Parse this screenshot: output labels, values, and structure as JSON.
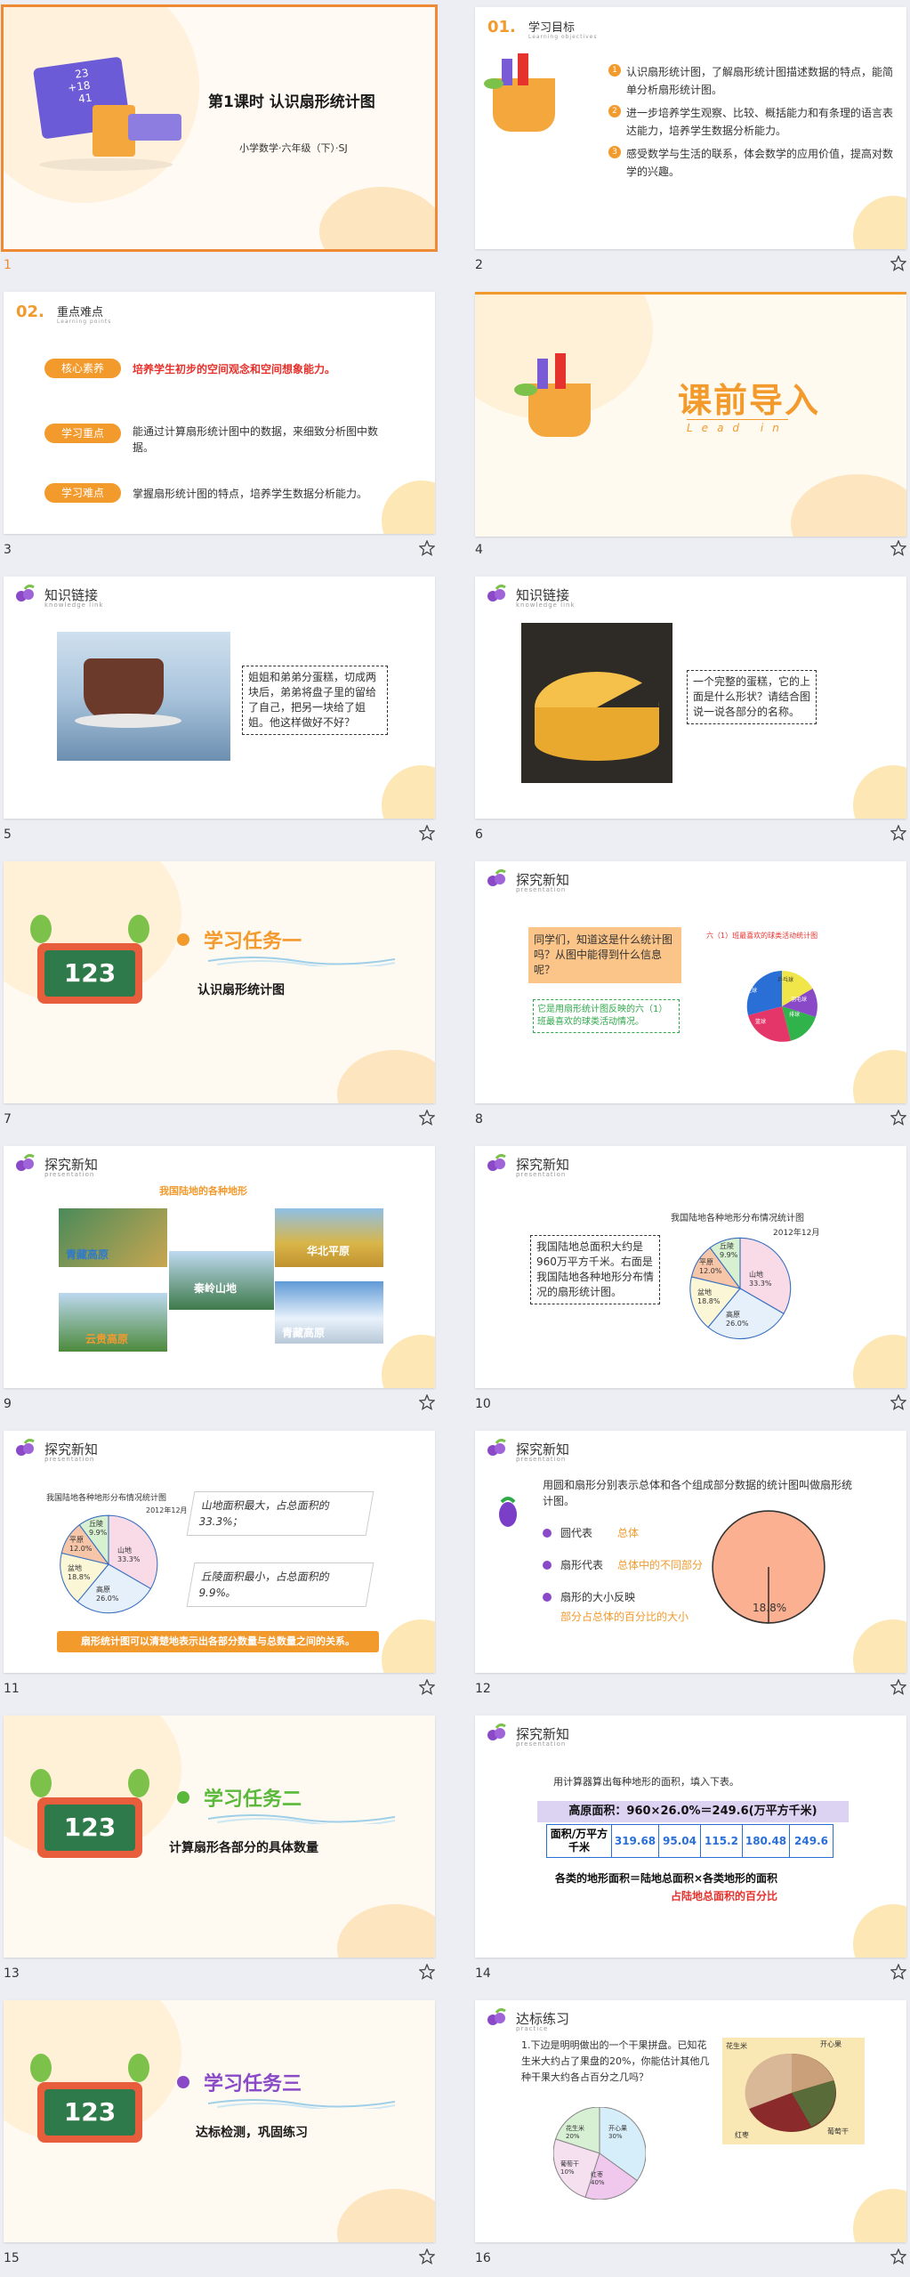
{
  "slides": [
    {
      "num": "1",
      "title": "第1课时 认识扇形统计图",
      "subtitle": "小学数学·六年级（下）·SJ",
      "board": [
        "23",
        "+18",
        "41"
      ]
    },
    {
      "num": "2",
      "section_no": "01.",
      "heading": "学习目标",
      "heading_en": "Learning objectives",
      "goals": [
        "认识扇形统计图，了解扇形统计图描述数据的特点，能简单分析扇形统计图。",
        "进一步培养学生观察、比较、概括能力和有条理的语言表达能力，培养学生数据分析能力。",
        "感受数学与生活的联系，体会数学的应用价值，提高对数学的兴趣。"
      ]
    },
    {
      "num": "3",
      "section_no": "02.",
      "heading": "重点难点",
      "heading_en": "Learning points",
      "rows": [
        {
          "tag": "核心素养",
          "text": "培养学生初步的空间观念和空间想象能力。"
        },
        {
          "tag": "学习重点",
          "text": "能通过计算扇形统计图中的数据，来细致分析图中数据。"
        },
        {
          "tag": "学习难点",
          "text": "掌握扇形统计图的特点，培养学生数据分析能力。"
        }
      ]
    },
    {
      "num": "4",
      "title": "课前导入",
      "title_en": "Lead  in"
    },
    {
      "num": "5",
      "heading": "知识链接",
      "heading_en": "knowledge link",
      "bubble": "姐姐和弟弟分蛋糕，切成两块后，弟弟将盘子里的留给了自己，把另一块给了姐姐。他这样做好不好？"
    },
    {
      "num": "6",
      "heading": "知识链接",
      "heading_en": "knowledge link",
      "bubble": "一个完整的蛋糕，它的上面是什么形状？请结合图说一说各部分的名称。"
    },
    {
      "num": "7",
      "task": "学习任务一",
      "task_sub": "认识扇形统计图"
    },
    {
      "num": "8",
      "heading": "探究新知",
      "heading_en": "presentation",
      "q": "同学们，知道这是什么统计图吗？从图中能得到什么信息呢？",
      "ans": "它是用扇形统计图反映的六（1）班最喜欢的球类活动情况。",
      "chart_title": "六（1）班最喜欢的球类活动统计图",
      "pie_labels": [
        "乒乓球",
        "羽毛球",
        "排球",
        "篮球",
        "足球"
      ]
    },
    {
      "num": "9",
      "heading": "探究新知",
      "heading_en": "presentation",
      "title": "我国陆地的各种地形",
      "places": [
        "青藏高原",
        "华北平原",
        "秦岭山地",
        "云贵高原",
        "青藏高原"
      ]
    },
    {
      "num": "10",
      "heading": "探究新知",
      "heading_en": "presentation",
      "text": "我国陆地总面积大约是960万平方千米。右面是我国陆地各种地形分布情况的扇形统计图。",
      "chart_title": "我国陆地各种地形分布情况统计图",
      "chart_date": "2012年12月",
      "pie": [
        "丘陵 9.9%",
        "平原 12.0%",
        "山地 33.3%",
        "盆地 18.8%",
        "高原 26.0%"
      ]
    },
    {
      "num": "11",
      "heading": "探究新知",
      "heading_en": "presentation",
      "chart_title": "我国陆地各种地形分布情况统计图",
      "chart_date": "2012年12月",
      "pie": [
        "丘陵 9.9%",
        "平原 12.0%",
        "山地 33.3%",
        "盆地 18.8%",
        "高原 26.0%"
      ],
      "note1": "山地面积最大，占总面积的33.3%；",
      "note2": "丘陵面积最小，占总面积的9.9%。",
      "banner": "扇形统计图可以清楚地表示出各部分数量与总数量之间的关系。"
    },
    {
      "num": "12",
      "heading": "探究新知",
      "heading_en": "presentation",
      "intro": "用圆和扇形分别表示总体和各个组成部分数据的统计图叫做扇形统计图。",
      "items": [
        {
          "k": "圆代表",
          "v": "总体"
        },
        {
          "k": "扇形代表",
          "v": "总体中的不同部分"
        },
        {
          "k": "扇形的大小反映",
          "v": "部分占总体的百分比的大小"
        }
      ],
      "pct": "18.8%"
    },
    {
      "num": "13",
      "task": "学习任务二",
      "task_sub": "计算扇形各部分的具体数量"
    },
    {
      "num": "14",
      "heading": "探究新知",
      "heading_en": "presentation",
      "intro": "用计算器算出每种地形的面积，填入下表。",
      "formula": "高原面积：960×26.0%＝249.6(万平方千米)",
      "row_head": "面积/万平方千米",
      "values": [
        "319.68",
        "95.04",
        "115.2",
        "180.48",
        "249.6"
      ],
      "eq1": "各类的地形面积＝陆地总面积×各类地形的面积",
      "eq2": "占陆地总面积的百分比"
    },
    {
      "num": "15",
      "task": "学习任务三",
      "task_sub": "达标检测，巩固练习"
    },
    {
      "num": "16",
      "heading": "达标练习",
      "heading_en": "practice",
      "q": "1.下边是明明做出的一个干果拼盘。已知花生米大约占了果盘的20%，你能估计其他几种干果大约各占百分之几吗？",
      "pie": [
        "花生米 20%",
        "开心果 30%",
        "红枣 40%",
        "葡萄干 10%"
      ],
      "photo_labels": [
        "花生米",
        "开心果",
        "葡萄干",
        "红枣"
      ]
    }
  ],
  "colors": {
    "accent": "#f39a2d",
    "selected": "#ee8a35",
    "title": "#1a1a1a",
    "red": "#e5322d"
  }
}
